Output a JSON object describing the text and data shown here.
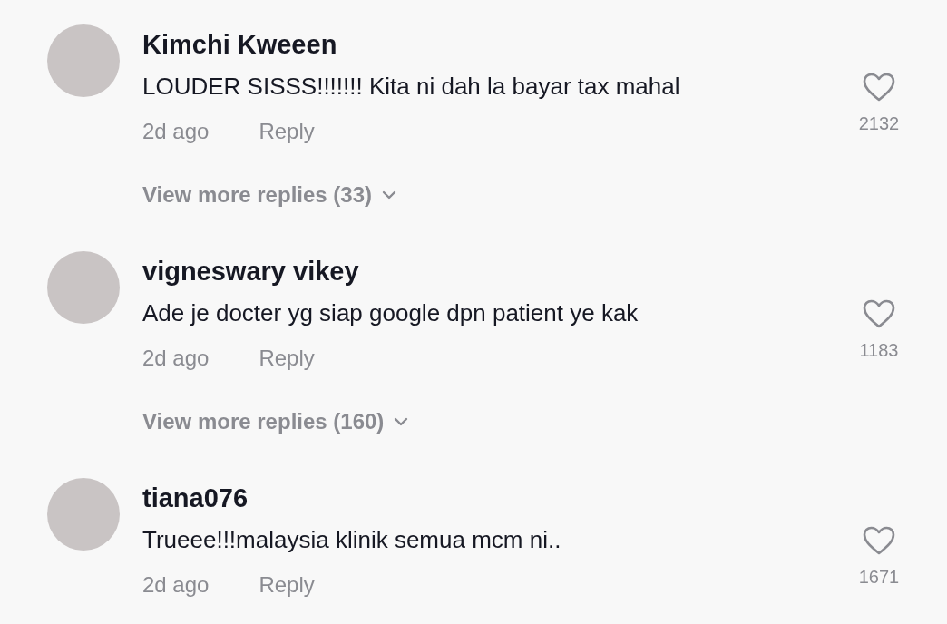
{
  "comments": [
    {
      "username": "Kimchi Kweeen",
      "text": "LOUDER SISSS!!!!!!! Kita ni dah la bayar tax mahal",
      "time": "2d ago",
      "reply": "Reply",
      "likes": "2132",
      "view_more": "View more replies (33)"
    },
    {
      "username": "vigneswary vikey",
      "text": "Ade je docter yg siap google dpn patient ye kak",
      "time": "2d ago",
      "reply": "Reply",
      "likes": "1183",
      "view_more": "View more replies (160)"
    },
    {
      "username": "tiana076",
      "text": "Trueee!!!malaysia klinik semua mcm ni..",
      "time": "2d ago",
      "reply": "Reply",
      "likes": "1671"
    }
  ]
}
